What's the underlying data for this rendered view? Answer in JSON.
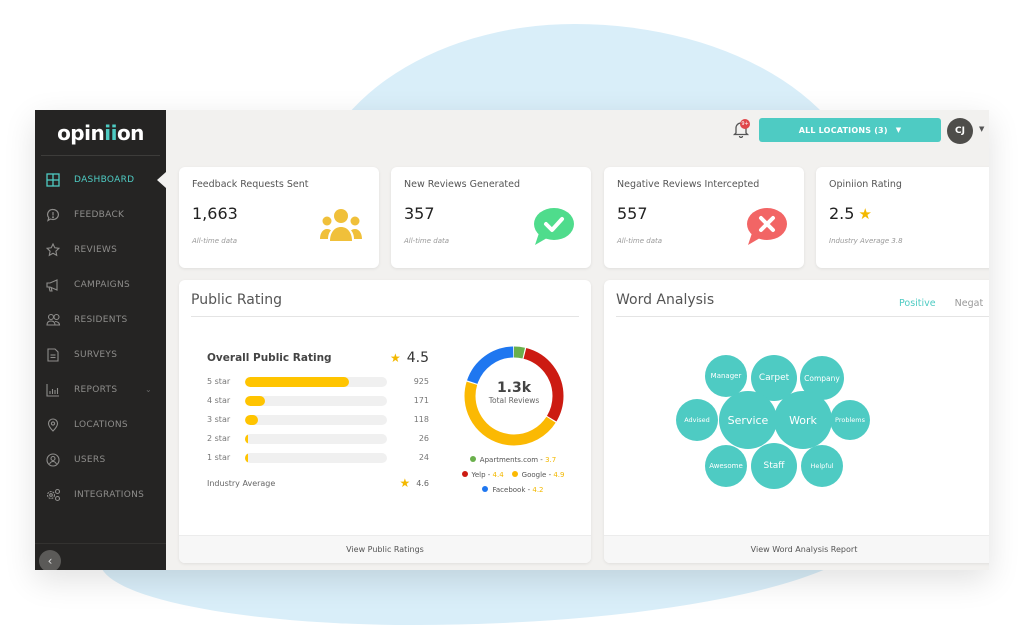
{
  "brand": {
    "name_pre": "opin",
    "name_accent": "ii",
    "name_post": "on",
    "accent_color": "#4ecbc3"
  },
  "sidebar": {
    "items": [
      {
        "label": "DASHBOARD",
        "icon": "grid-icon",
        "active": true
      },
      {
        "label": "FEEDBACK",
        "icon": "chat-alert-icon"
      },
      {
        "label": "REVIEWS",
        "icon": "star-icon"
      },
      {
        "label": "CAMPAIGNS",
        "icon": "megaphone-icon"
      },
      {
        "label": "RESIDENTS",
        "icon": "users-icon"
      },
      {
        "label": "SURVEYS",
        "icon": "document-icon"
      },
      {
        "label": "REPORTS",
        "icon": "bar-chart-icon",
        "has_submenu": true
      },
      {
        "label": "LOCATIONS",
        "icon": "map-pin-icon"
      },
      {
        "label": "USERS",
        "icon": "user-circle-icon"
      },
      {
        "label": "INTEGRATIONS",
        "icon": "gears-icon"
      }
    ],
    "collapse_glyph": "‹"
  },
  "topbar": {
    "notification_badge": "9+",
    "location_button": "ALL LOCATIONS (3)",
    "avatar_initials": "CJ"
  },
  "stats": [
    {
      "title": "Feedback Requests Sent",
      "value": "1,663",
      "sub": "All-time data",
      "icon": "group-icon",
      "color": "#f0c03a"
    },
    {
      "title": "New Reviews Generated",
      "value": "357",
      "sub": "All-time data",
      "icon": "check-bubble-icon",
      "color": "#4fdc8c"
    },
    {
      "title": "Negative Reviews Intercepted",
      "value": "557",
      "sub": "All-time data",
      "icon": "x-bubble-icon",
      "color": "#f26565"
    },
    {
      "title": "Opiniion Rating",
      "value": "2.5",
      "sub": "Industry Average 3.8",
      "icon": "people-talking-icon",
      "color": "#4ecbc3"
    }
  ],
  "public_rating": {
    "title": "Public Rating",
    "overall_label": "Overall Public Rating",
    "overall_value": "4.5",
    "rows": [
      {
        "label": "5 star",
        "count": 925,
        "fill_fraction": 0.73
      },
      {
        "label": "4 star",
        "count": 171,
        "fill_fraction": 0.14
      },
      {
        "label": "3 star",
        "count": 118,
        "fill_fraction": 0.09
      },
      {
        "label": "2 star",
        "count": 26,
        "fill_fraction": 0.02
      },
      {
        "label": "1 star",
        "count": 24,
        "fill_fraction": 0.02
      }
    ],
    "industry_label": "Industry Average",
    "industry_value": "4.6",
    "total_value": "1.3k",
    "total_label": "Total Reviews",
    "sources": [
      {
        "name": "Apartments.com",
        "rating": "3.7",
        "color": "#6ab04c",
        "share": 0.04
      },
      {
        "name": "Yelp",
        "rating": "4.4",
        "color": "#cc1b12",
        "share": 0.3
      },
      {
        "name": "Google",
        "rating": "4.9",
        "color": "#fbb903",
        "share": 0.46
      },
      {
        "name": "Facebook",
        "rating": "4.2",
        "color": "#1f77f0",
        "share": 0.2
      }
    ],
    "footer": "View Public Ratings"
  },
  "word_analysis": {
    "title": "Word Analysis",
    "tabs": [
      {
        "label": "Positive",
        "active": true
      },
      {
        "label": "Negat"
      }
    ],
    "words": [
      "Manager",
      "Carpet",
      "Company",
      "Advised",
      "Service",
      "Work",
      "Problems",
      "Awesome",
      "Staff",
      "Helpful"
    ],
    "footer": "View Word Analysis Report"
  }
}
